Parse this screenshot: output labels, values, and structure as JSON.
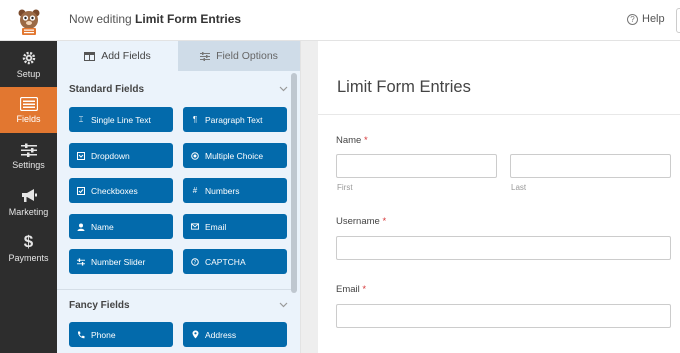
{
  "header": {
    "editing_prefix": "Now editing",
    "form_name": "Limit Form Entries",
    "help_label": "Help",
    "help_icon": "question-circle-icon"
  },
  "sidebar": {
    "items": [
      {
        "label": "Setup",
        "icon": "gear-icon",
        "active": false
      },
      {
        "label": "Fields",
        "icon": "fields-list-icon",
        "active": true
      },
      {
        "label": "Settings",
        "icon": "sliders-icon",
        "active": false
      },
      {
        "label": "Marketing",
        "icon": "megaphone-icon",
        "active": false
      },
      {
        "label": "Payments",
        "icon": "dollar-icon",
        "active": false
      }
    ]
  },
  "panel": {
    "tabs": [
      {
        "label": "Add Fields",
        "icon": "table-icon",
        "active": true
      },
      {
        "label": "Field Options",
        "icon": "sliders-icon",
        "active": false
      }
    ],
    "standard_fields": {
      "title": "Standard Fields",
      "buttons": [
        {
          "label": "Single Line Text",
          "icon": "text-cursor-icon"
        },
        {
          "label": "Paragraph Text",
          "icon": "paragraph-icon"
        },
        {
          "label": "Dropdown",
          "icon": "dropdown-icon"
        },
        {
          "label": "Multiple Choice",
          "icon": "radio-icon"
        },
        {
          "label": "Checkboxes",
          "icon": "checkbox-icon"
        },
        {
          "label": "Numbers",
          "icon": "hash-icon"
        },
        {
          "label": "Name",
          "icon": "user-icon"
        },
        {
          "label": "Email",
          "icon": "envelope-icon"
        },
        {
          "label": "Number Slider",
          "icon": "slider-icon"
        },
        {
          "label": "CAPTCHA",
          "icon": "captcha-icon"
        }
      ]
    },
    "fancy_fields": {
      "title": "Fancy Fields",
      "buttons": [
        {
          "label": "Phone",
          "icon": "phone-icon"
        },
        {
          "label": "Address",
          "icon": "map-pin-icon"
        }
      ]
    }
  },
  "preview": {
    "form_title": "Limit Form Entries",
    "fields": [
      {
        "label": "Name",
        "required_mark": "*",
        "sublabels": [
          "First",
          "Last"
        ]
      },
      {
        "label": "Username",
        "required_mark": "*"
      },
      {
        "label": "Email",
        "required_mark": "*"
      }
    ]
  },
  "colors": {
    "accent": "#e27730",
    "button": "#036aab",
    "sidebar_bg": "#2d2d2d",
    "panel_bg": "#ebf3fb"
  }
}
